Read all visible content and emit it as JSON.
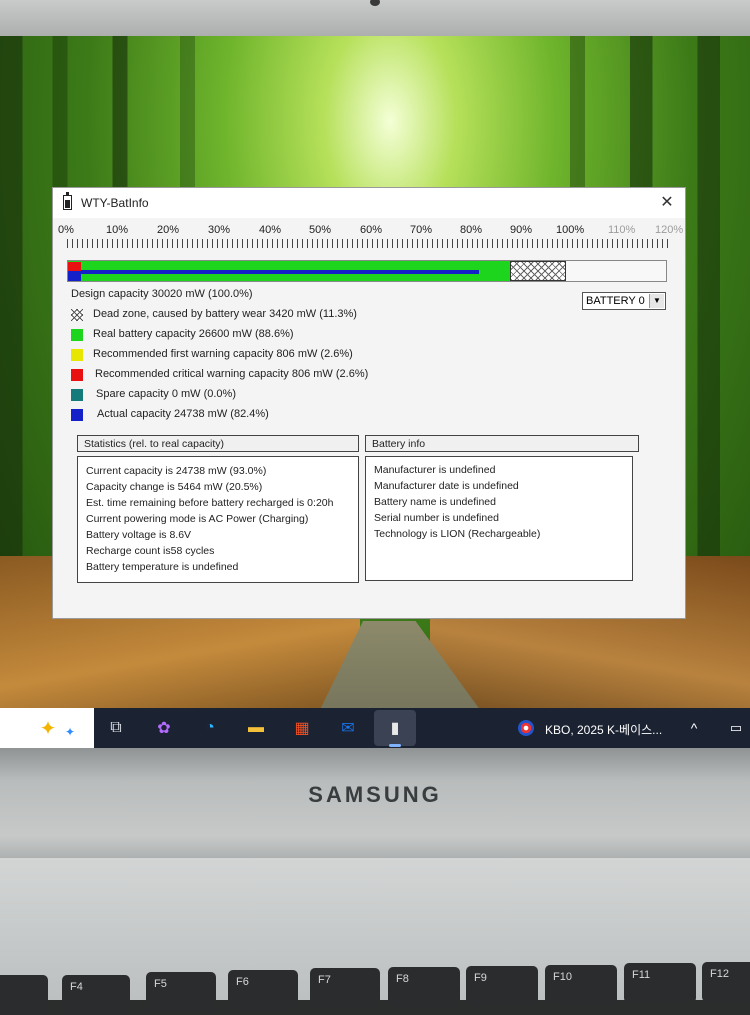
{
  "window": {
    "title": "WTY-BatInfo",
    "close_glyph": "✕"
  },
  "ruler": {
    "ticks": [
      "0%",
      "10%",
      "20%",
      "30%",
      "40%",
      "50%",
      "60%",
      "70%",
      "80%",
      "90%",
      "100%",
      "110%",
      "120%"
    ]
  },
  "capacity_bar": {
    "real_capacity_pct": 88.6,
    "dead_zone_pct": 11.3,
    "actual_capacity_pct": 82.4,
    "warning_pct": 2.6,
    "critical_pct": 2.6
  },
  "legend": {
    "design": "Design capacity 30020 mW (100.0%)",
    "dead_zone": "Dead zone, caused by battery wear 3420 mW (11.3%)",
    "real": "Real battery capacity 26600 mW (88.6%)",
    "warning": "Recommended first warning capacity 806 mW (2.6%)",
    "critical": "Recommended critical warning capacity 806 mW (2.6%)",
    "spare": "Spare capacity  0 mW (0.0%)",
    "actual": "Actual capacity 24738 mW (82.4%)"
  },
  "colors": {
    "real": "#1ed51e",
    "warning": "#e6e600",
    "critical": "#e81010",
    "spare": "#147a7a",
    "actual": "#1420c8"
  },
  "battery_select": {
    "value": "BATTERY 0"
  },
  "statistics": {
    "header": "Statistics (rel. to real capacity)",
    "lines": [
      "Current capacity is 24738 mW (93.0%)",
      "Capacity change is 5464 mW (20.5%)",
      "Est. time remaining before battery recharged is 0:20h",
      "Current powering mode is AC Power (Charging)",
      "Battery voltage is 8.6V",
      "Recharge count is58 cycles",
      "Battery temperature is undefined"
    ]
  },
  "battery_info": {
    "header": "Battery info",
    "lines": [
      "Manufacturer is undefined",
      "Manufacturer date is undefined",
      "Battery name is undefined",
      "Serial number is undefined",
      "Technology is LION (Rechargeable)"
    ]
  },
  "taskbar": {
    "news": "KBO, 2025 K-베이스...",
    "icons": [
      "copilot-icon",
      "task-view-icon",
      "copilot-app-icon",
      "edge-icon",
      "file-explorer-icon",
      "store-icon",
      "outlook-icon",
      "batinfo-icon"
    ],
    "tray_chevron": "^"
  },
  "laptop": {
    "brand": "SAMSUNG",
    "keys": [
      "F4",
      "F5",
      "F6",
      "F7",
      "F8",
      "F9",
      "F10",
      "F11",
      "F12"
    ]
  }
}
